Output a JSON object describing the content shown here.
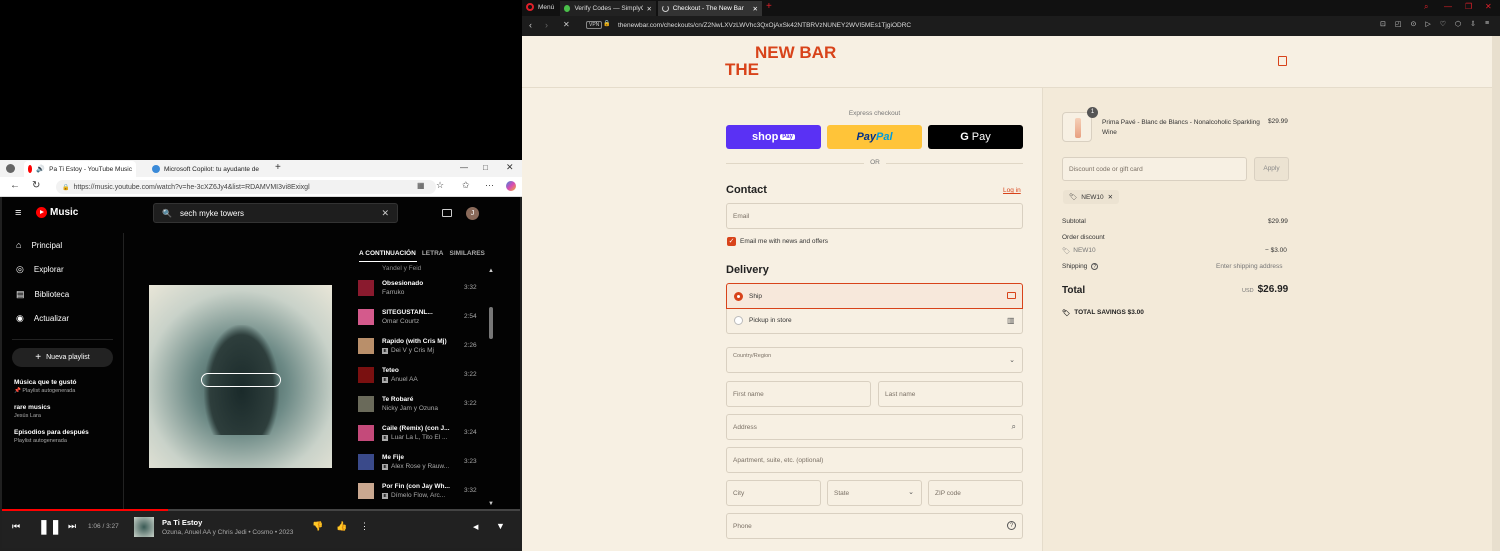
{
  "edge": {
    "tabs": [
      {
        "label": "Pa Ti Estoy - YouTube Music"
      },
      {
        "label": "Microsoft Copilot: tu ayudante de"
      }
    ],
    "url": "https://music.youtube.com/watch?v=he-3cXZ6Jy4&list=RDAMVMI3vi8Exixgl"
  },
  "ytm": {
    "logo": "Music",
    "search_value": "sech myke towers",
    "avatar": "J",
    "nav": [
      {
        "label": "Principal",
        "icon": "home-icon"
      },
      {
        "label": "Explorar",
        "icon": "compass-icon"
      },
      {
        "label": "Biblioteca",
        "icon": "library-icon"
      },
      {
        "label": "Actualizar",
        "icon": "upgrade-icon"
      }
    ],
    "new_playlist": "Nueva playlist",
    "playlists": [
      {
        "title": "Música que te gustó",
        "sub": "Playlist autogenerada"
      },
      {
        "title": "rare musics",
        "sub": "Jesús Lara"
      },
      {
        "title": "Episodios para después",
        "sub": "Playlist autogenerada"
      }
    ],
    "tabs": [
      "A CONTINUACIÓN",
      "LETRA",
      "SIMILARES"
    ],
    "queue_partial": "Yandel y Feid",
    "queue": [
      {
        "title": "Obsesionado",
        "artist": "Farruko",
        "duration": "3:32",
        "explicit": false,
        "color": "#8a1a2e"
      },
      {
        "title": "SITEGUSTANL...",
        "artist": "Omar Courtz",
        "duration": "2:54",
        "explicit": false,
        "color": "#d45a8c"
      },
      {
        "title": "Rapido (with Cris Mj)",
        "artist": "Dei V y Cris Mj",
        "duration": "2:26",
        "explicit": true,
        "color": "#b98f6a"
      },
      {
        "title": "Teteo",
        "artist": "Anuel AA",
        "duration": "3:22",
        "explicit": true,
        "color": "#7a1010"
      },
      {
        "title": "Te Robaré",
        "artist": "Nicky Jam y Ozuna",
        "duration": "3:22",
        "explicit": false,
        "color": "#6a6a5a"
      },
      {
        "title": "Caile (Remix) (con J...",
        "artist": "Luar La L, Tito El ...",
        "duration": "3:24",
        "explicit": true,
        "color": "#c44a7a"
      },
      {
        "title": "Me Fije",
        "artist": "Alex Rose y Rauw...",
        "duration": "3:23",
        "explicit": true,
        "color": "#3a4a8a"
      },
      {
        "title": "Por Fin (con Jay Wh...",
        "artist": "Dímelo Flow, Arc...",
        "duration": "3:32",
        "explicit": true,
        "color": "#caa890"
      }
    ],
    "player": {
      "time": "1:06 / 3:27",
      "progress": 0.32,
      "title": "Pa Ti Estoy",
      "subtitle": "Ozuna, Anuel AA y Chris Jedi • Cosmo • 2023"
    }
  },
  "opera": {
    "menu": "Menú",
    "tabs": [
      {
        "label": "Verify Codes — SimplyCod"
      },
      {
        "label": "Checkout - The New Bar"
      }
    ],
    "url": "thenewbar.com/checkouts/cn/Z2NwLXVzLWVhc3QxOjAxSk42NTBRVzNUNEY2WVI5MEs1TjgiODRC",
    "vpn": "VPN"
  },
  "checkout": {
    "brand_top": "NEW BAR",
    "brand_the": "THE",
    "express_label": "Express checkout",
    "shop_pay": "shop",
    "shop_pay_badge": "Pay",
    "paypal_a": "Pay",
    "paypal_b": "Pal",
    "gpay_g": "G",
    "gpay": "Pay",
    "or": "OR",
    "contact_title": "Contact",
    "login": "Log in",
    "email_placeholder": "Email",
    "email_opt": "Email me with news and offers",
    "delivery_title": "Delivery",
    "ship": "Ship",
    "pickup": "Pickup in store",
    "country_label": "Country/Region",
    "first_name": "First name",
    "last_name": "Last name",
    "address": "Address",
    "apartment": "Apartment, suite, etc. (optional)",
    "city": "City",
    "state": "State",
    "zip": "ZIP code",
    "phone": "Phone",
    "item": {
      "qty": "1",
      "name": "Prima Pavé - Blanc de Blancs - Nonalcoholic Sparkling Wine",
      "price": "$29.99"
    },
    "discount_placeholder": "Discount code or gift card",
    "apply": "Apply",
    "code": "NEW10",
    "subtotal_label": "Subtotal",
    "subtotal": "$29.99",
    "order_discount_label": "Order discount",
    "discount_code": "NEW10",
    "discount_value": "− $3.00",
    "shipping_label": "Shipping",
    "shipping_value": "Enter shipping address",
    "total_label": "Total",
    "currency": "USD",
    "total": "$26.99",
    "savings": "TOTAL SAVINGS  $3.00"
  }
}
